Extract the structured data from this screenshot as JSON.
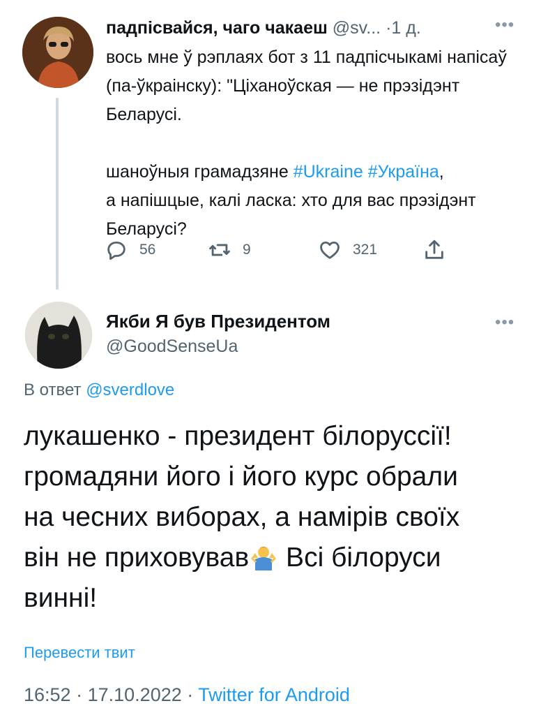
{
  "parent_tweet": {
    "author_name": "падпісвайся, чаго чакаеш",
    "handle": "@sv...",
    "separator": "·",
    "time": "1 д.",
    "more_icon": "more-icon",
    "text_intro": "вось мне ў рэплаях бот з 11 падпісчыкамі напісаў (па-ўкраінску): \"Ціханоўская — не прэзідэнт Беларусі.\n\nшаноўныя грамадзяне ",
    "hashtag_1": "#Ukraine",
    "hashtag_2": "#Україна",
    "text_outro": ",\nа напішцые, калі ласка: хто для вас прэзідэнт Беларусі?",
    "replies": "56",
    "retweets": "9",
    "likes": "321"
  },
  "main_tweet": {
    "author_name": "Якби Я був Президентом",
    "handle": "@GoodSenseUa",
    "more_icon": "more-icon",
    "reply_prefix": "В ответ",
    "reply_mention": "@sverdlove",
    "text_part1": "лукашенко - президент білоруссії!\nгромадяни його і його курс обрали\nна чесних виборах, а намірів своїх\nвін не приховував",
    "emoji": "person-shrugging",
    "text_part2": " Всі білоруси\nвинні!",
    "translate_label": "Перевести твит",
    "time": "16:52",
    "date": "17.10.2022",
    "separator": "·",
    "source": "Twitter for Android"
  },
  "colors": {
    "accent": "#1d9bf0",
    "secondary_text": "#536471",
    "primary_text": "#0f1419"
  }
}
